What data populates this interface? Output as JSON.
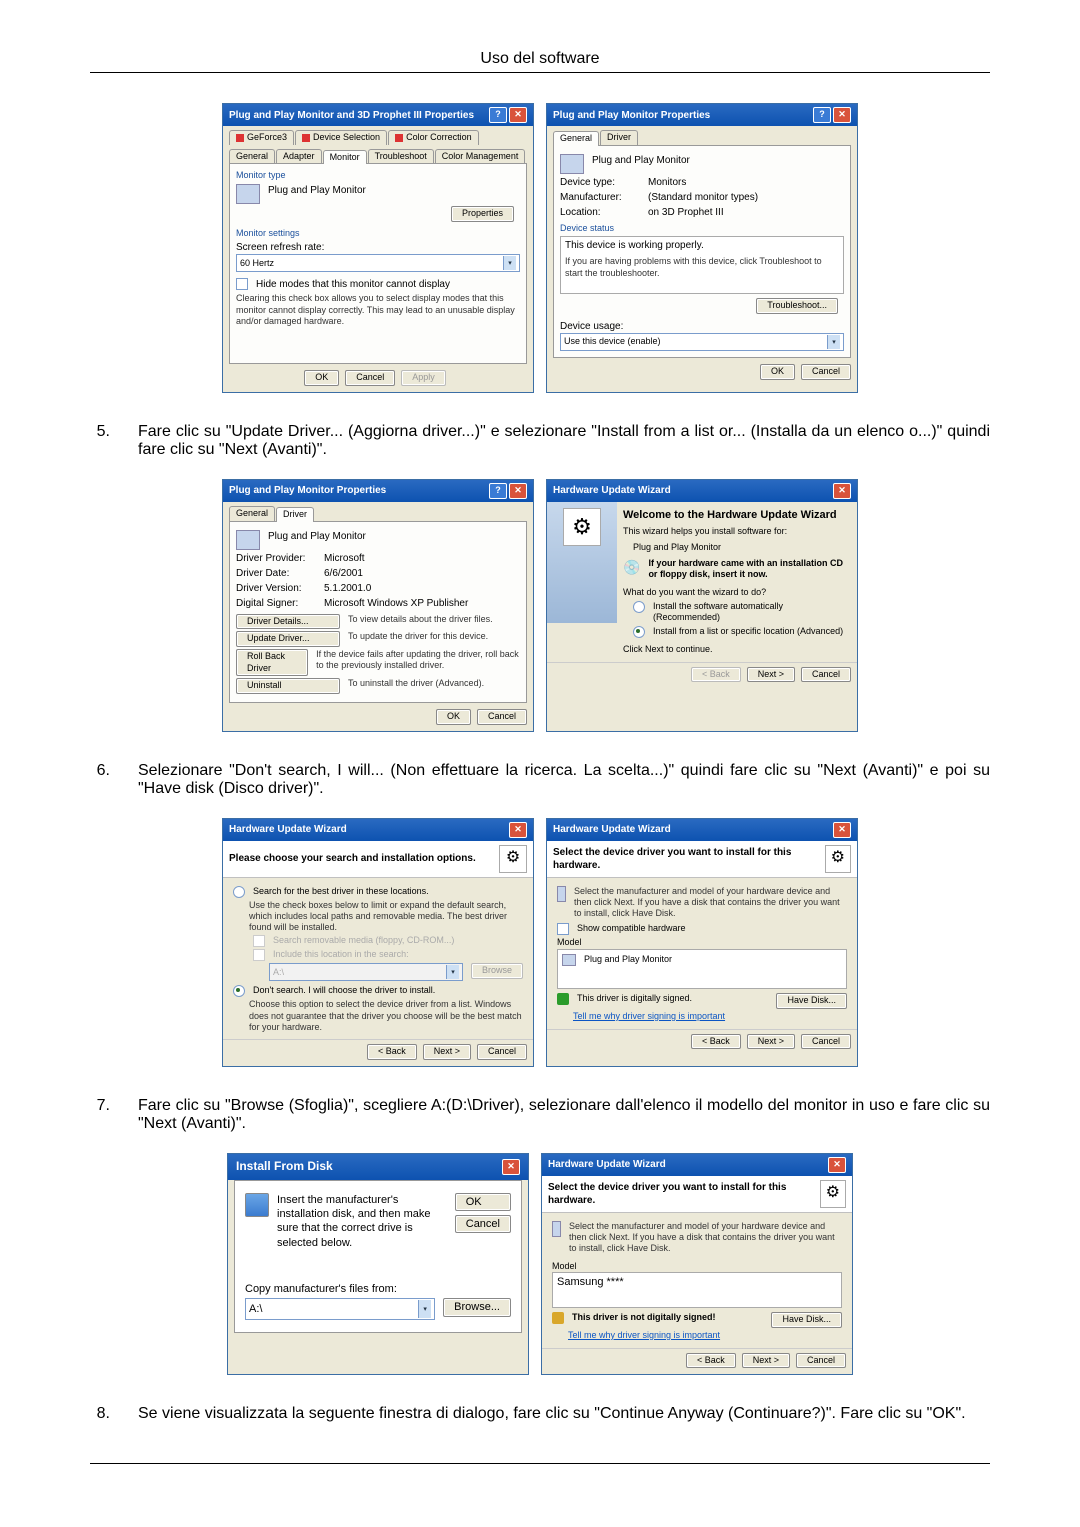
{
  "header": {
    "title": "Uso del software"
  },
  "dlg1_left": {
    "title": "Plug and Play Monitor and 3D Prophet III Properties",
    "tabs_top": {
      "t1": "GeForce3",
      "t2": "Device Selection",
      "t3": "Color Correction"
    },
    "tabs_bottom": {
      "t1": "General",
      "t2": "Adapter",
      "t3": "Monitor",
      "t4": "Troubleshoot",
      "t5": "Color Management"
    },
    "monitor_type_label": "Monitor type",
    "monitor_name": "Plug and Play Monitor",
    "properties_btn": "Properties",
    "monitor_settings_label": "Monitor settings",
    "refresh_label": "Screen refresh rate:",
    "refresh_value": "60 Hertz",
    "hide_modes": "Hide modes that this monitor cannot display",
    "hide_modes_note": "Clearing this check box allows you to select display modes that this monitor cannot display correctly. This may lead to an unusable display and/or damaged hardware.",
    "ok": "OK",
    "cancel": "Cancel",
    "apply": "Apply"
  },
  "dlg1_right": {
    "title": "Plug and Play Monitor Properties",
    "tabs": {
      "t1": "General",
      "t2": "Driver"
    },
    "heading": "Plug and Play Monitor",
    "dev_type_l": "Device type:",
    "dev_type_v": "Monitors",
    "manuf_l": "Manufacturer:",
    "manuf_v": "(Standard monitor types)",
    "loc_l": "Location:",
    "loc_v": "on 3D Prophet III",
    "status_label": "Device status",
    "status_text": "This device is working properly.",
    "status_help": "If you are having problems with this device, click Troubleshoot to start the troubleshooter.",
    "troubleshoot_btn": "Troubleshoot...",
    "usage_label": "Device usage:",
    "usage_value": "Use this device (enable)",
    "ok": "OK",
    "cancel": "Cancel"
  },
  "step5": "Fare clic su \"Update Driver... (Aggiorna driver...)\" e selezionare \"Install from a list or... (Installa da un elenco o...)\" quindi fare clic su \"Next (Avanti)\".",
  "dlg2_left": {
    "title": "Plug and Play Monitor Properties",
    "tabs": {
      "t1": "General",
      "t2": "Driver"
    },
    "heading": "Plug and Play Monitor",
    "prov_l": "Driver Provider:",
    "prov_v": "Microsoft",
    "date_l": "Driver Date:",
    "date_v": "6/6/2001",
    "ver_l": "Driver Version:",
    "ver_v": "5.1.2001.0",
    "sign_l": "Digital Signer:",
    "sign_v": "Microsoft Windows XP Publisher",
    "details_btn": "Driver Details...",
    "details_txt": "To view details about the driver files.",
    "update_btn": "Update Driver...",
    "update_txt": "To update the driver for this device.",
    "rollback_btn": "Roll Back Driver",
    "rollback_txt": "If the device fails after updating the driver, roll back to the previously installed driver.",
    "uninstall_btn": "Uninstall",
    "uninstall_txt": "To uninstall the driver (Advanced).",
    "ok": "OK",
    "cancel": "Cancel"
  },
  "dlg2_right": {
    "title": "Hardware Update Wizard",
    "welcome": "Welcome to the Hardware Update Wizard",
    "intro": "This wizard helps you install software for:",
    "device": "Plug and Play Monitor",
    "cd_hint": "If your hardware came with an installation CD or floppy disk, insert it now.",
    "what_do": "What do you want the wizard to do?",
    "opt_auto": "Install the software automatically (Recommended)",
    "opt_list": "Install from a list or specific location (Advanced)",
    "click_next": "Click Next to continue.",
    "back": "< Back",
    "next": "Next >",
    "cancel": "Cancel"
  },
  "step6": "Selezionare \"Don't search, I will... (Non effettuare la ricerca. La scelta...)\" quindi fare clic su \"Next (Avanti)\" e poi su \"Have disk (Disco driver)\".",
  "dlg3_left": {
    "title": "Hardware Update Wizard",
    "header": "Please choose your search and installation options.",
    "opt_search": "Search for the best driver in these locations.",
    "opt_search_note": "Use the check boxes below to limit or expand the default search, which includes local paths and removable media. The best driver found will be installed.",
    "chk_removable": "Search removable media (floppy, CD-ROM...)",
    "chk_include": "Include this location in the search:",
    "path_value": "A:\\",
    "browse": "Browse",
    "opt_dont": "Don't search. I will choose the driver to install.",
    "opt_dont_note": "Choose this option to select the device driver from a list. Windows does not guarantee that the driver you choose will be the best match for your hardware.",
    "back": "< Back",
    "next": "Next >",
    "cancel": "Cancel"
  },
  "dlg3_right": {
    "title": "Hardware Update Wizard",
    "header": "Select the device driver you want to install for this hardware.",
    "instr": "Select the manufacturer and model of your hardware device and then click Next. If you have a disk that contains the driver you want to install, click Have Disk.",
    "show_compat": "Show compatible hardware",
    "model_label": "Model",
    "model_value": "Plug and Play Monitor",
    "signed": "This driver is digitally signed.",
    "tell_me": "Tell me why driver signing is important",
    "have_disk": "Have Disk...",
    "back": "< Back",
    "next": "Next >",
    "cancel": "Cancel"
  },
  "step7": "Fare clic su \"Browse (Sfoglia)\", scegliere A:(D:\\Driver), selezionare dall'elenco il modello del monitor in uso e fare clic su \"Next (Avanti)\".",
  "dlg4_left": {
    "title": "Install From Disk",
    "instr": "Insert the manufacturer's installation disk, and then make sure that the correct drive is selected below.",
    "ok": "OK",
    "cancel": "Cancel",
    "copy_label": "Copy manufacturer's files from:",
    "path": "A:\\",
    "browse": "Browse..."
  },
  "dlg4_right": {
    "title": "Hardware Update Wizard",
    "header": "Select the device driver you want to install for this hardware.",
    "instr": "Select the manufacturer and model of your hardware device and then click Next. If you have a disk that contains the driver you want to install, click Have Disk.",
    "model_label": "Model",
    "model_value": "Samsung ****",
    "not_signed": "This driver is not digitally signed!",
    "tell_me": "Tell me why driver signing is important",
    "have_disk": "Have Disk...",
    "back": "< Back",
    "next": "Next >",
    "cancel": "Cancel"
  },
  "step8": "Se viene visualizzata la seguente finestra di dialogo, fare clic su \"Continue Anyway (Continuare?)\". Fare clic su \"OK\".",
  "steps": {
    "n5": "5.",
    "n6": "6.",
    "n7": "7.",
    "n8": "8."
  }
}
